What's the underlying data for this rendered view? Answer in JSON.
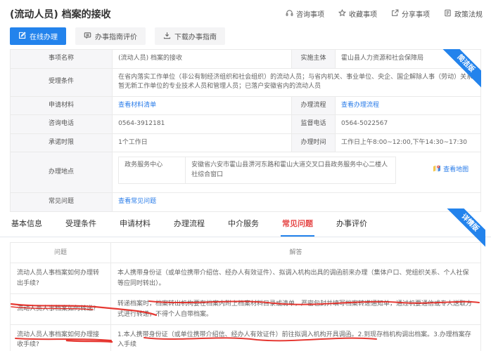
{
  "colors": {
    "primary": "#2383ec",
    "tab_active": "#e64949",
    "annotation": "#e3241d"
  },
  "header": {
    "title": "(流动人员) 档案的接收",
    "buttons": {
      "online": "在线办理",
      "evaluate": "办事指南评价",
      "download": "下载办事指南"
    },
    "quick_links": {
      "consult": "咨询事项",
      "favorite": "收藏事项",
      "share": "分享事项",
      "policy": "政策法规"
    }
  },
  "ribbons": {
    "concise": "简洁版",
    "detailed": "详情版"
  },
  "info": {
    "item_name_label": "事项名称",
    "item_name": "(流动人员) 档案的接收",
    "agency_label": "实施主体",
    "agency": "霍山县人力资源和社会保障局",
    "conditions_label": "受理条件",
    "conditions": "在省内落实工作单位（非公有制经济组织和社会组织）的流动人员；与省内机关、事业单位、央企、国企解除人事（劳动）关系暂无新工作单位的专业技术人员和管理人员；已落户安徽省内的流动人员",
    "materials_label": "申请材料",
    "materials_link": "查看材料清单",
    "process_label": "办理流程",
    "process_link": "查看办理流程",
    "consult_phone_label": "咨询电话",
    "consult_phone": "0564-3912181",
    "supervise_phone_label": "监督电话",
    "supervise_phone": "0564-5022567",
    "time_limit_label": "承诺时限",
    "time_limit": "1个工作日",
    "office_hours_label": "办理时间",
    "office_hours": "工作日上午8:00~12:00,下午14:30~17:30",
    "location_label": "办理地点",
    "location_center": "政务服务中心",
    "location_address": "安徽省六安市霍山县淠河东路和霍山大道交叉口县政务服务中心二楼人社综合窗口",
    "map_link": "查看地图",
    "faq_label": "常见问题",
    "faq_link": "查看常见问题"
  },
  "tabs": {
    "active_index": 5,
    "items": [
      {
        "label": "基本信息"
      },
      {
        "label": "受理条件"
      },
      {
        "label": "申请材料"
      },
      {
        "label": "办理流程"
      },
      {
        "label": "中介服务"
      },
      {
        "label": "常见问题"
      },
      {
        "label": "办事评价"
      }
    ]
  },
  "faq": {
    "question_header": "问题",
    "answer_header": "解答",
    "rows": [
      {
        "question": "流动人员人事档案如何办理转出手续?",
        "answer": "本人携带身份证（或单位携带介绍信、经办人有效证件）、拟调入机构出具的调函前来办理（集体户口、党组织关系、个人社保等应同时转出）。"
      },
      {
        "question": "流动人员人事档案如何转递?",
        "answer": "转递档案时，档案转出机构要在档案内附上档案材料目录或清单，严密包封并填写档案转递通知单，通过机要通信或专人送取方式进行转递，不得个人自带档案。"
      },
      {
        "question": "流动人员人事档案如何办理接收手续?",
        "answer": "1.本人携带身份证（或单位携带介绍信、经办人有效证件）前往拟调入机构开具调函。2.到现存档机构调出档案。3.办理档案存入手续"
      }
    ]
  }
}
